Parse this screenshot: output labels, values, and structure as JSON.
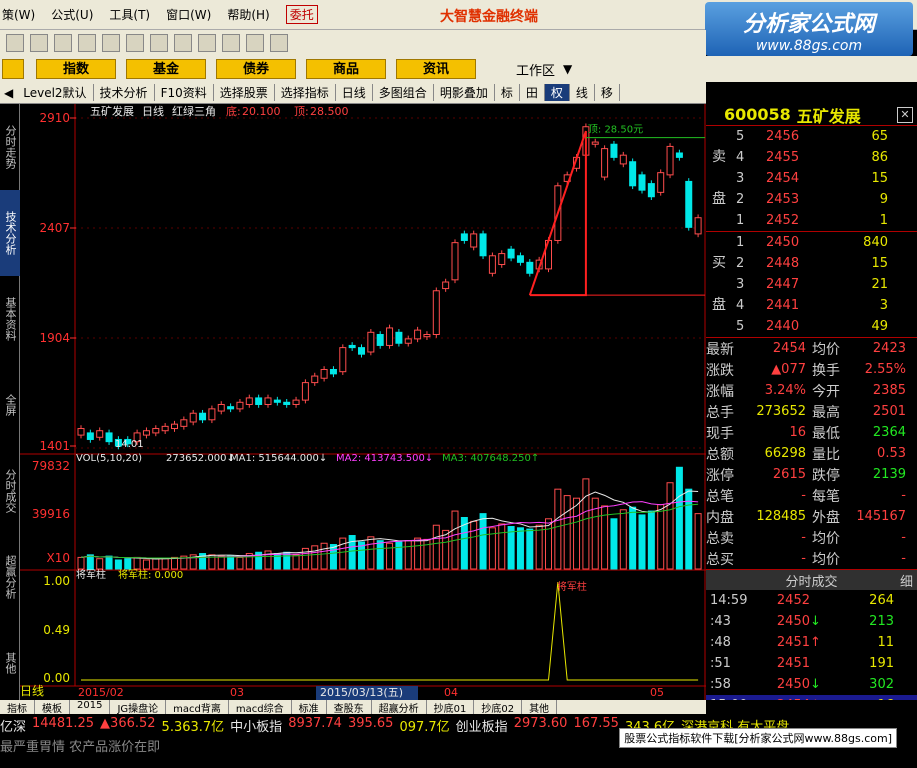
{
  "menu": [
    "策(W)",
    "公式(U)",
    "工具(T)",
    "窗口(W)",
    "帮助(H)",
    "委托"
  ],
  "app_title": "大智慧金融终端",
  "logo": {
    "name": "分析家公式网",
    "url": "www.88gs.com"
  },
  "quick_tabs": [
    "指数",
    "基金",
    "债券",
    "商品",
    "资讯"
  ],
  "workspace": "工作区",
  "tabs": [
    "Level2默认",
    "技术分析",
    "F10资料",
    "选择股票",
    "选择指标",
    "日线",
    "多图组合",
    "明影叠加",
    "标",
    "田",
    "权",
    "线",
    "移"
  ],
  "side_tabs": [
    "分时走势",
    "技术分析",
    "基本资料",
    "全屏",
    "分时成交",
    "超赢分析",
    "其他"
  ],
  "chart_header": {
    "name": "五矿发展",
    "period": "日线",
    "indicator": "红绿三角",
    "low_label": "底:",
    "low": "20.100",
    "high_label": "顶:",
    "high": "28.500"
  },
  "price_axis": [
    "2910",
    "2407",
    "1904",
    "1401"
  ],
  "peak_label": "顶: 28.50元",
  "low_marker": "14.01",
  "vol_header": {
    "label": "VOL(5,10,20)",
    "vol": "273652.000↓",
    "ma1": "MA1: 515644.000↓",
    "ma2": "MA2: 413743.500↓",
    "ma3": "MA3: 407648.250↑"
  },
  "vol_axis": [
    "79832",
    "39916",
    "X10"
  ],
  "jjz_header": {
    "label": "将军柱",
    "value": "将军柱: 0.000"
  },
  "jjz_axis": [
    "1.00",
    "0.49",
    "0.00"
  ],
  "jjz_tag": "将军柱",
  "date_axis": {
    "period": "日线",
    "labels": [
      "2015/02",
      "03",
      "2015/03/13(五)",
      "04",
      "05"
    ]
  },
  "bottom_tabs": [
    "指标",
    "模板",
    "2015",
    "JG操盘论",
    "macd背离",
    "macd综合",
    "标准",
    "查股东",
    "超赢分析",
    "抄底01",
    "抄底02",
    "其他"
  ],
  "stock": {
    "code": "600058",
    "name": "五矿发展"
  },
  "sell": [
    {
      "n": "5",
      "p": "2456",
      "v": "65"
    },
    {
      "n": "4",
      "p": "2455",
      "v": "86"
    },
    {
      "n": "3",
      "p": "2454",
      "v": "15"
    },
    {
      "n": "2",
      "p": "2453",
      "v": "9"
    },
    {
      "n": "1",
      "p": "2452",
      "v": "1"
    }
  ],
  "buy": [
    {
      "n": "1",
      "p": "2450",
      "v": "840"
    },
    {
      "n": "2",
      "p": "2448",
      "v": "15"
    },
    {
      "n": "3",
      "p": "2447",
      "v": "21"
    },
    {
      "n": "4",
      "p": "2441",
      "v": "3"
    },
    {
      "n": "5",
      "p": "2440",
      "v": "49"
    }
  ],
  "sell_label": [
    "卖",
    "盘"
  ],
  "buy_label": [
    "买",
    "盘"
  ],
  "stats": [
    {
      "l": "最新",
      "v": "2454",
      "l2": "均价",
      "v2": "2423"
    },
    {
      "l": "涨跌",
      "v": "▲077",
      "l2": "换手",
      "v2": "2.55%"
    },
    {
      "l": "涨幅",
      "v": "3.24%",
      "l2": "今开",
      "v2": "2385"
    },
    {
      "l": "总手",
      "v": "273652",
      "l2": "最高",
      "v2": "2501"
    },
    {
      "l": "现手",
      "v": "16",
      "l2": "最低",
      "v2": "2364"
    },
    {
      "l": "总额",
      "v": "66298",
      "l2": "量比",
      "v2": "0.53"
    },
    {
      "l": "涨停",
      "v": "2615",
      "l2": "跌停",
      "v2": "2139"
    },
    {
      "l": "总笔",
      "v": "-",
      "l2": "每笔",
      "v2": "-"
    },
    {
      "l": "内盘",
      "v": "128485",
      "l2": "外盘",
      "v2": "145167"
    },
    {
      "l": "总卖",
      "v": "-",
      "l2": "均价",
      "v2": "-"
    },
    {
      "l": "总买",
      "v": "-",
      "l2": "均价",
      "v2": "-"
    }
  ],
  "ticks_title": "分时成交",
  "ticks_btn": "细",
  "ticks": [
    {
      "t": "14:59",
      "p": "2452",
      "a": "",
      "v": "264"
    },
    {
      "t": ":43",
      "p": "2450",
      "a": "↓",
      "v": "213"
    },
    {
      "t": ":48",
      "p": "2451",
      "a": "↑",
      "v": "11"
    },
    {
      "t": ":51",
      "p": "2451",
      "a": "",
      "v": "191"
    },
    {
      "t": ":58",
      "p": "2450",
      "a": "↓",
      "v": "302"
    },
    {
      "t": "15:00",
      "p": "2454",
      "a": "↑",
      "v": "16"
    }
  ],
  "right_tabs": [
    "细",
    "价",
    "指",
    "势",
    "联",
    "讯",
    "评",
    "短"
  ],
  "ticker": [
    {
      "t": "亿深",
      "c": "#e8e8e8"
    },
    {
      "t": "14481.25",
      "c": "#ff4040"
    },
    {
      "t": "▲366.52",
      "c": "#ff4040"
    },
    {
      "t": "5.363.7亿",
      "c": "#e8e800"
    },
    {
      "t": "中小板指",
      "c": "#e8e8e8"
    },
    {
      "t": "8937.74",
      "c": "#ff4040"
    },
    {
      "t": "395.65",
      "c": "#ff4040"
    },
    {
      "t": "097.7亿",
      "c": "#e8e800"
    },
    {
      "t": "创业板指",
      "c": "#e8e8e8"
    },
    {
      "t": "2973.60",
      "c": "#ff4040"
    },
    {
      "t": "167.55",
      "c": "#ff4040"
    },
    {
      "t": "343.6亿",
      "c": "#e8e800"
    },
    {
      "t": "深港京科 有大平盘",
      "c": "#e8e800"
    }
  ],
  "news": "最严重胃情 农产品涨价在即",
  "watermark": "股票公式指标软件下载[分析家公式网www.88gs.com]",
  "chart_data": {
    "type": "candlestick",
    "title": "五矿发展 日线",
    "ylim": [
      1401,
      2910
    ],
    "candles": [
      {
        "o": 1460,
        "c": 1490
      },
      {
        "o": 1470,
        "c": 1440
      },
      {
        "o": 1450,
        "c": 1480
      },
      {
        "o": 1470,
        "c": 1430
      },
      {
        "o": 1440,
        "c": 1410
      },
      {
        "o": 1440,
        "c": 1420
      },
      {
        "o": 1430,
        "c": 1470
      },
      {
        "o": 1460,
        "c": 1480
      },
      {
        "o": 1470,
        "c": 1490
      },
      {
        "o": 1480,
        "c": 1500
      },
      {
        "o": 1490,
        "c": 1510
      },
      {
        "o": 1500,
        "c": 1530
      },
      {
        "o": 1520,
        "c": 1560
      },
      {
        "o": 1560,
        "c": 1530
      },
      {
        "o": 1530,
        "c": 1580
      },
      {
        "o": 1570,
        "c": 1600
      },
      {
        "o": 1590,
        "c": 1580
      },
      {
        "o": 1580,
        "c": 1610
      },
      {
        "o": 1600,
        "c": 1630
      },
      {
        "o": 1630,
        "c": 1600
      },
      {
        "o": 1600,
        "c": 1630
      },
      {
        "o": 1620,
        "c": 1610
      },
      {
        "o": 1610,
        "c": 1600
      },
      {
        "o": 1600,
        "c": 1620
      },
      {
        "o": 1620,
        "c": 1700
      },
      {
        "o": 1700,
        "c": 1730
      },
      {
        "o": 1720,
        "c": 1760
      },
      {
        "o": 1760,
        "c": 1740
      },
      {
        "o": 1750,
        "c": 1860
      },
      {
        "o": 1870,
        "c": 1860
      },
      {
        "o": 1860,
        "c": 1830
      },
      {
        "o": 1840,
        "c": 1930
      },
      {
        "o": 1920,
        "c": 1870
      },
      {
        "o": 1870,
        "c": 1950
      },
      {
        "o": 1930,
        "c": 1880
      },
      {
        "o": 1880,
        "c": 1900
      },
      {
        "o": 1900,
        "c": 1940
      },
      {
        "o": 1910,
        "c": 1920
      },
      {
        "o": 1920,
        "c": 2120
      },
      {
        "o": 2130,
        "c": 2160
      },
      {
        "o": 2170,
        "c": 2340
      },
      {
        "o": 2380,
        "c": 2350
      },
      {
        "o": 2320,
        "c": 2380
      },
      {
        "o": 2380,
        "c": 2280
      },
      {
        "o": 2200,
        "c": 2280
      },
      {
        "o": 2240,
        "c": 2290
      },
      {
        "o": 2310,
        "c": 2270
      },
      {
        "o": 2280,
        "c": 2250
      },
      {
        "o": 2250,
        "c": 2200
      },
      {
        "o": 2220,
        "c": 2260
      },
      {
        "o": 2220,
        "c": 2350
      },
      {
        "o": 2350,
        "c": 2600
      },
      {
        "o": 2620,
        "c": 2650
      },
      {
        "o": 2680,
        "c": 2730
      },
      {
        "o": 2740,
        "c": 2870
      },
      {
        "o": 2790,
        "c": 2800
      },
      {
        "o": 2640,
        "c": 2770
      },
      {
        "o": 2790,
        "c": 2730
      },
      {
        "o": 2700,
        "c": 2740
      },
      {
        "o": 2710,
        "c": 2600
      },
      {
        "o": 2650,
        "c": 2580
      },
      {
        "o": 2610,
        "c": 2550
      },
      {
        "o": 2570,
        "c": 2660
      },
      {
        "o": 2650,
        "c": 2780
      },
      {
        "o": 2750,
        "c": 2730
      },
      {
        "o": 2620,
        "c": 2410
      },
      {
        "o": 2380,
        "c": 2454
      }
    ],
    "volume": [
      9,
      11,
      8,
      10,
      7,
      8,
      9,
      7,
      8,
      8,
      9,
      10,
      11,
      12,
      11,
      10,
      10,
      9,
      12,
      13,
      14,
      12,
      13,
      11,
      16,
      18,
      20,
      19,
      24,
      26,
      21,
      25,
      22,
      20,
      21,
      22,
      24,
      23,
      34,
      30,
      45,
      40,
      37,
      43,
      32,
      35,
      33,
      32,
      31,
      34,
      39,
      62,
      57,
      55,
      70,
      55,
      49,
      39,
      46,
      48,
      42,
      45,
      50,
      67,
      79,
      62,
      43
    ],
    "jjz": {
      "signal_index": 51,
      "value": 1.0
    }
  }
}
